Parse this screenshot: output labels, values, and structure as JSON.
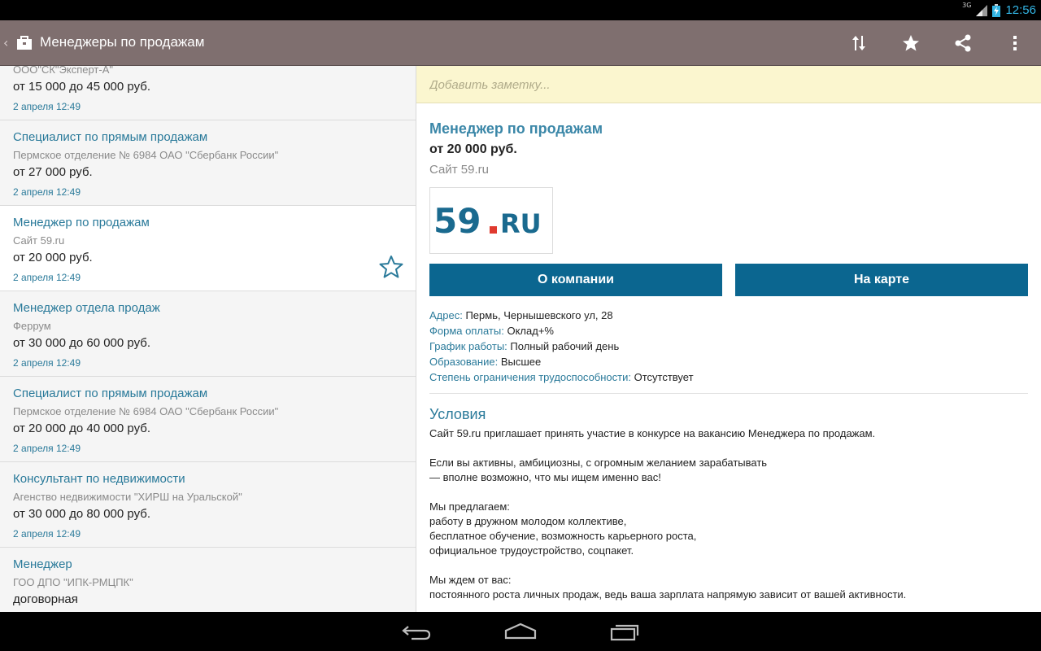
{
  "status_bar": {
    "network": "3G",
    "time": "12:56"
  },
  "action_bar": {
    "title": "Менеджеры по продажам",
    "actions": [
      "sort-icon",
      "star-icon",
      "share-icon",
      "overflow-icon"
    ]
  },
  "list": {
    "items": [
      {
        "title": "",
        "company": "ООО\"СК\"Эксперт-А\"",
        "salary": "от 15 000 до 45 000 руб.",
        "date": "2 апреля 12:49"
      },
      {
        "title": "Специалист по прямым продажам",
        "company": "Пермское отделение № 6984 ОАО \"Сбербанк России\"",
        "salary": "от 27 000 руб.",
        "date": "2 апреля 12:49"
      },
      {
        "title": "Менеджер по продажам",
        "company": "Сайт 59.ru",
        "salary": "от 20 000 руб.",
        "date": "2 апреля 12:49"
      },
      {
        "title": "Менеджер отдела продаж",
        "company": "Феррум",
        "salary": "от 30 000 до 60 000 руб.",
        "date": "2 апреля 12:49"
      },
      {
        "title": "Специалист по прямым продажам",
        "company": "Пермское отделение № 6984 ОАО \"Сбербанк России\"",
        "salary": "от 20 000 до 40 000 руб.",
        "date": "2 апреля 12:49"
      },
      {
        "title": "Консультант по недвижимости",
        "company": "Агенство недвижимости \"ХИРШ на Уральской\"",
        "salary": "от 30 000 до 80 000 руб.",
        "date": "2 апреля 12:49"
      },
      {
        "title": "Менеджер",
        "company": "ГОО ДПО \"ИПК-РМЦПК\"",
        "salary": "договорная",
        "date": ""
      }
    ]
  },
  "detail": {
    "note_placeholder": "Добавить заметку...",
    "title": "Менеджер по продажам",
    "salary": "от 20 000 руб.",
    "company": "Сайт 59.ru",
    "logo": {
      "main": "59",
      "suffix": "RU"
    },
    "buttons": {
      "company": "О компании",
      "map": "На карте"
    },
    "props": [
      {
        "label": "Адрес:",
        "value": "Пермь, Чернышевского ул, 28"
      },
      {
        "label": "Форма оплаты:",
        "value": "Оклад+%"
      },
      {
        "label": "График работы:",
        "value": "Полный рабочий день"
      },
      {
        "label": "Образование:",
        "value": "Высшее"
      },
      {
        "label": "Степень ограничения трудоспособности:",
        "value": "Отсутствует"
      }
    ],
    "conditions_title": "Условия",
    "conditions_lines": [
      "Сайт 59.ru приглашает принять участие в конкурсе на вакансию Менеджера по продажам.",
      "",
      "Если вы активны, амбициозны, с огромным желанием зарабатывать",
      "— вполне возможно, что мы ищем именно вас!",
      "",
      "Мы предлагаем:",
      "работу в дружном молодом коллективе,",
      "бесплатное обучение, возможность карьерного роста,",
      "официальное трудоустройство, соцпакет.",
      "",
      "Мы ждем от вас:",
      "постоянного роста личных продаж, ведь ваша зарплата напрямую зависит от вашей активности."
    ]
  },
  "colors": {
    "action_bar": "#7f6f6f",
    "accent": "#2a7a9a",
    "button": "#0b6690",
    "note_bg": "#fbf6cf",
    "logo_blue": "#1a6a8f",
    "logo_red": "#e03a2f"
  },
  "nav_bar": {
    "buttons": [
      "back-icon",
      "home-icon",
      "recents-icon"
    ]
  }
}
